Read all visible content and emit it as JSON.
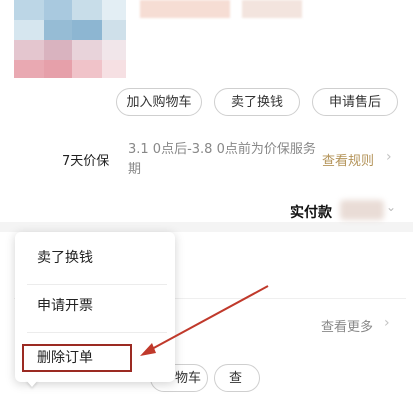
{
  "colors": {
    "accent_gold": "#b4945a",
    "highlight_red": "#9b2a22",
    "annotation_arrow": "#c0392b"
  },
  "order_actions": {
    "add_to_cart": "加入购物车",
    "sell_for_cash": "卖了换钱",
    "after_sales": "申请售后"
  },
  "price_protect": {
    "label": "7天价保",
    "desc": "3.1 0点后-3.8 0点前为价保服务期",
    "rule_link": "查看规则",
    "rule_arrow": "›"
  },
  "payment": {
    "paid_label": "实付款",
    "chevron": "⌄"
  },
  "more": {
    "label": "查看更多",
    "arrow": "›"
  },
  "popup_menu": {
    "items": [
      "卖了换钱",
      "申请开票",
      "删除订单"
    ]
  },
  "bottom_buttons": {
    "partial_1": "物车",
    "partial_2": "查"
  }
}
